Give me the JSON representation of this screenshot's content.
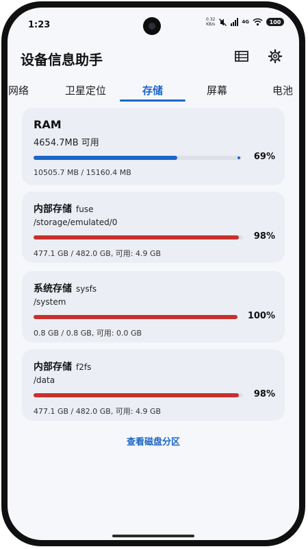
{
  "status_bar": {
    "time": "1:23",
    "net_speed_value": "0.32",
    "net_speed_unit": "KB/s",
    "network_type": "4G",
    "battery": "100"
  },
  "header": {
    "title": "设备信息助手",
    "list_icon": "list-icon",
    "settings_icon": "gear-icon"
  },
  "tabs": [
    {
      "label": "网络"
    },
    {
      "label": "卫星定位"
    },
    {
      "label": "存储",
      "active": true
    },
    {
      "label": "屏幕"
    },
    {
      "label": "电池"
    }
  ],
  "ram": {
    "title": "RAM",
    "available": "4654.7MB 可用",
    "percent_label": "69%",
    "percent_value": 69,
    "detail": "10505.7 MB / 15160.4 MB",
    "color": "#1b66c8"
  },
  "storage": [
    {
      "title": "内部存储",
      "fs": "fuse",
      "path": "/storage/emulated/0",
      "percent_label": "98%",
      "percent_value": 98,
      "detail": "477.1 GB / 482.0 GB, 可用: 4.9 GB",
      "color": "#c8302b"
    },
    {
      "title": "系统存储",
      "fs": "sysfs",
      "path": "/system",
      "percent_label": "100%",
      "percent_value": 100,
      "detail": "0.8 GB / 0.8 GB, 可用: 0.0 GB",
      "color": "#c8302b"
    },
    {
      "title": "内部存储",
      "fs": "f2fs",
      "path": "/data",
      "percent_label": "98%",
      "percent_value": 98,
      "detail": "477.1 GB / 482.0 GB, 可用: 4.9 GB",
      "color": "#c8302b"
    }
  ],
  "footer": {
    "partition_link": "查看磁盘分区"
  }
}
